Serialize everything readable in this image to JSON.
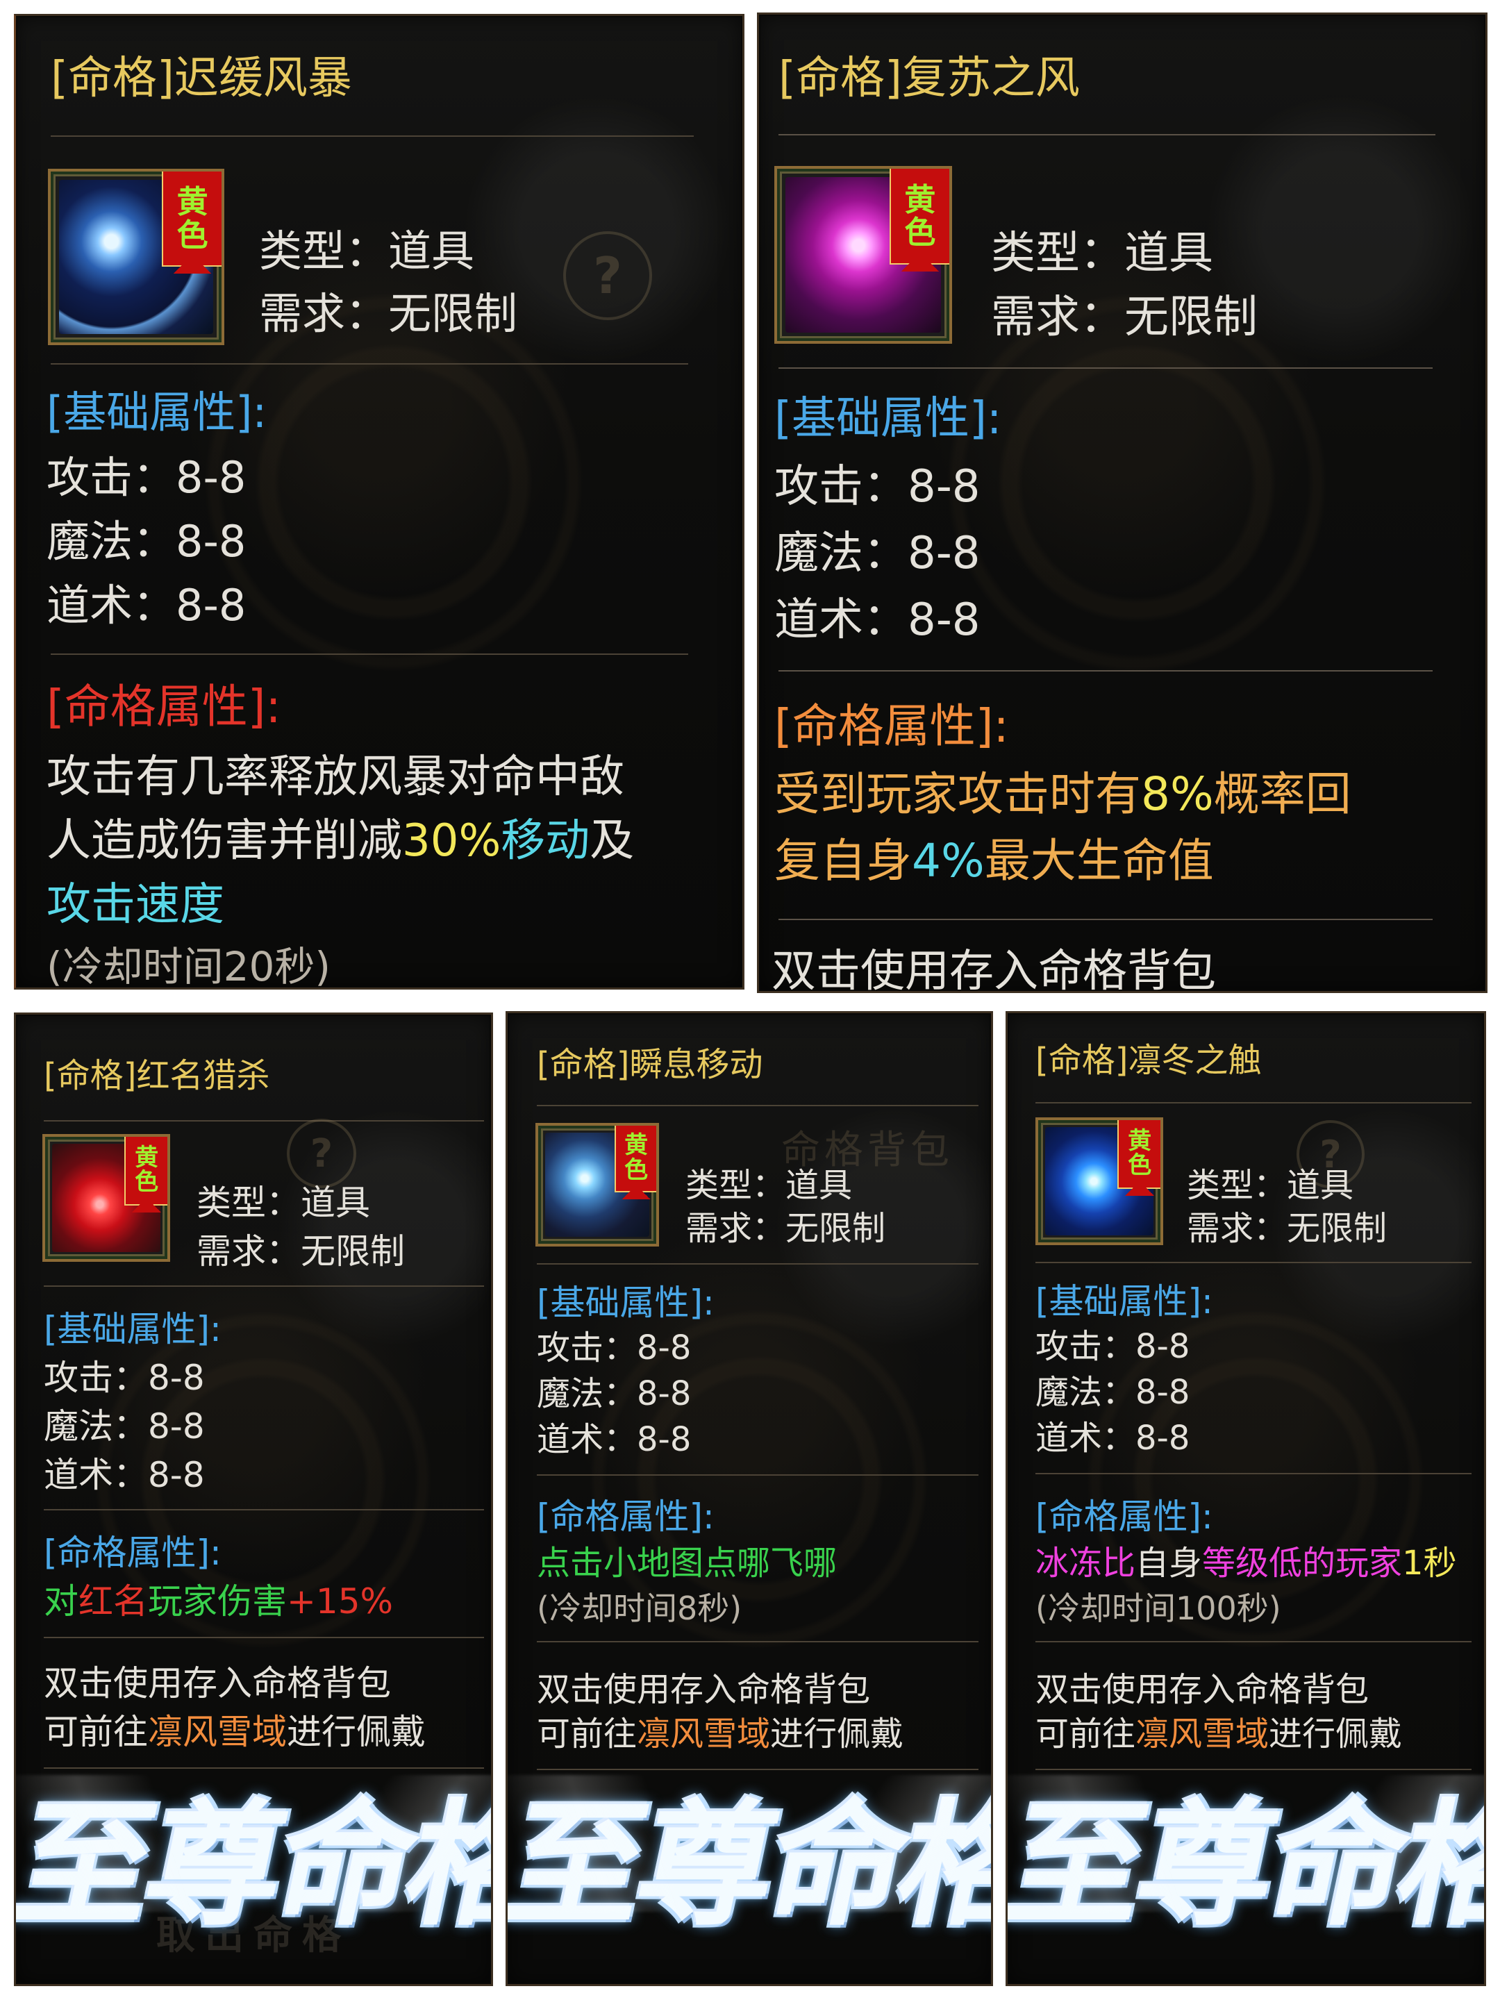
{
  "cards": [
    {
      "title": "[命格]迟缓风暴",
      "icon": {
        "name": "storm-skill-icon",
        "tag_line1": "黄",
        "tag_line2": "色"
      },
      "info": {
        "type": "类型：道具",
        "requirement": "需求：无限制"
      },
      "basic": {
        "header": "[基础属性]:",
        "attack": "攻击：8-8",
        "magic": "魔法：8-8",
        "tao": "道术：8-8"
      },
      "fate": {
        "header": "[命格属性]:",
        "line1": "攻击有几率释放风暴对命中敌",
        "line2_prefix": "人造成伤害并削减",
        "line2_percent": "30%",
        "line2_move": "移动",
        "line2_suffix": "及",
        "line3": "攻击速度",
        "cooldown": "(冷却时间20秒)"
      }
    },
    {
      "title": "[命格]复苏之风",
      "icon": {
        "name": "wind-burst-icon",
        "tag_line1": "黄",
        "tag_line2": "色"
      },
      "info": {
        "type": "类型：道具",
        "requirement": "需求：无限制"
      },
      "basic": {
        "header": "[基础属性]:",
        "attack": "攻击：8-8",
        "magic": "魔法：8-8",
        "tao": "道术：8-8"
      },
      "fate": {
        "header": "[命格属性]:",
        "line1_prefix": "受到玩家攻击时有",
        "line1_percent": "8%",
        "line1_suffix": "概率回",
        "line2_prefix": "复自身",
        "line2_percent": "4%",
        "line2_suffix": "最大生命值"
      },
      "usage": "双击使用存入命格背包"
    },
    {
      "title": "[命格]红名猎杀",
      "icon": {
        "name": "red-hunt-icon",
        "tag_line1": "黄",
        "tag_line2": "色"
      },
      "info": {
        "type": "类型：道具",
        "requirement": "需求：无限制"
      },
      "basic": {
        "header": "[基础属性]:",
        "attack": "攻击：8-8",
        "magic": "魔法：8-8",
        "tao": "道术：8-8"
      },
      "fate": {
        "header": "[命格属性]:",
        "prefix": "对",
        "red_name": "红名",
        "suffix": "玩家伤害",
        "bonus": "+15%"
      },
      "usage1": "双击使用存入命格背包",
      "usage2_prefix": "可前往",
      "usage2_location": "凛风雪域",
      "usage2_suffix": "进行佩戴",
      "banner": "至尊命格",
      "ghost_bottom": "取出命格"
    },
    {
      "title": "[命格]瞬息移动",
      "icon": {
        "name": "teleport-skill-icon",
        "tag_line1": "黄",
        "tag_line2": "色"
      },
      "info": {
        "type": "类型：道具",
        "requirement": "需求：无限制"
      },
      "basic": {
        "header": "[基础属性]:",
        "attack": "攻击：8-8",
        "magic": "魔法：8-8",
        "tao": "道术：8-8"
      },
      "fate": {
        "header": "[命格属性]:",
        "line1": "点击小地图点哪飞哪",
        "cooldown": "(冷却时间8秒)"
      },
      "ghost_top": "命格背包",
      "usage1": "双击使用存入命格背包",
      "usage2_prefix": "可前往",
      "usage2_location": "凛风雪域",
      "usage2_suffix": "进行佩戴",
      "banner": "至尊命格"
    },
    {
      "title": "[命格]凛冬之触",
      "icon": {
        "name": "frost-touch-icon",
        "tag_line1": "黄",
        "tag_line2": "色"
      },
      "info": {
        "type": "类型：道具",
        "requirement": "需求：无限制"
      },
      "basic": {
        "header": "[基础属性]:",
        "attack": "攻击：8-8",
        "magic": "魔法：8-8",
        "tao": "道术：8-8"
      },
      "fate": {
        "header": "[命格属性]:",
        "line1_prefix": "冰冻比",
        "line1_middle": "自身",
        "line1_suffix1": "等级低的玩家",
        "line1_suffix2": "1秒",
        "cooldown": "(冷却时间100秒)"
      },
      "usage1": "双击使用存入命格背包",
      "usage2_prefix": "可前往",
      "usage2_location": "凛风雪域",
      "usage2_suffix": "进行佩戴",
      "banner": "至尊命格"
    }
  ]
}
